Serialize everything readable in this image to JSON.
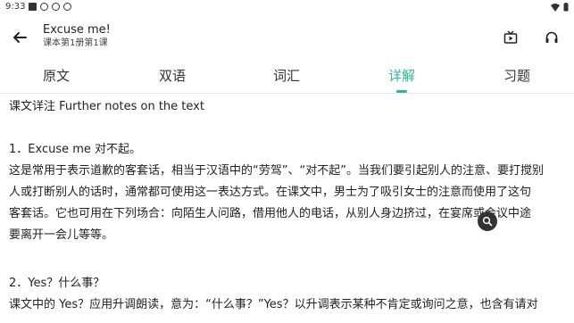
{
  "status_bar": {
    "time": "9:33"
  },
  "header": {
    "title": "Excuse me!",
    "subtitle": "课本第1册第1课"
  },
  "tabs": [
    {
      "label": "原文",
      "active": false
    },
    {
      "label": "双语",
      "active": false
    },
    {
      "label": "词汇",
      "active": false
    },
    {
      "label": "详解",
      "active": true
    },
    {
      "label": "习题",
      "active": false
    }
  ],
  "content": {
    "heading": "课文详注 Further notes on the text",
    "note1_title": "1．Excuse me 对不起。",
    "note1_lines": [
      "这是常用于表示道歉的客套话，相当于汉语中的“劳驾”、“对不起”。当我们要引起别人的注意、要打搅别",
      "人或打断别人的话时，通常都可使用这一表达方式。在课文中，男士为了吸引女士的注意而使用了这句",
      "客套话。它也可用在下列场合：向陌生人问路，借用他人的电话，从别人身边挤过，在宴席或会议中途",
      "要离开一会儿等等。"
    ],
    "note2_title": "2．Yes？什么事？",
    "note2_lines": [
      "课文中的 Yes？应用升调朗读，意为：“什么事？”Yes？以升调表示某种不肯定或询问之意，也含有请对"
    ]
  },
  "colors": {
    "accent": "#2fb796"
  },
  "icons": {
    "back": "arrow-left-icon",
    "video": "tv-icon",
    "audio": "headphones-icon",
    "search": "search-icon"
  }
}
